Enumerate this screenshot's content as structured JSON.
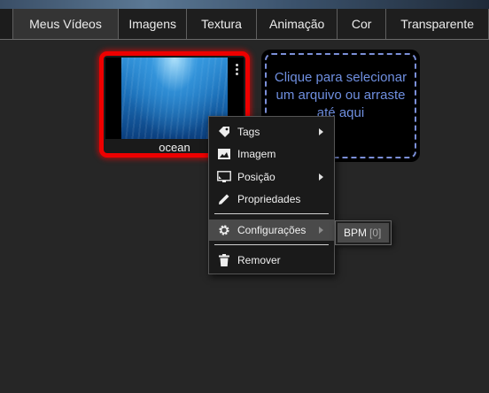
{
  "tabs": [
    {
      "label": "Meus Vídeos",
      "active": true
    },
    {
      "label": "Imagens"
    },
    {
      "label": "Textura"
    },
    {
      "label": "Animação"
    },
    {
      "label": "Cor"
    },
    {
      "label": "Transparente"
    }
  ],
  "video_card": {
    "name": "ocean",
    "selected": true,
    "border_color": "#ee0000"
  },
  "upload_box": {
    "text": "Clique para selecionar um arquivo ou arraste até aqui"
  },
  "context_menu": {
    "items": [
      {
        "label": "Tags",
        "icon": "tag-icon",
        "submenu": true
      },
      {
        "label": "Imagem",
        "icon": "image-icon"
      },
      {
        "label": "Posição",
        "icon": "screen-position-icon",
        "submenu": true
      },
      {
        "label": "Propriedades",
        "icon": "pencil-icon"
      },
      {
        "label": "Configurações",
        "icon": "gear-icon",
        "submenu": true,
        "highlighted": true
      },
      {
        "label": "Remover",
        "icon": "trash-icon"
      }
    ]
  },
  "submenu": {
    "label": "BPM",
    "count": "[0]"
  },
  "colors": {
    "accent_dashed": "#7b8fd8",
    "menu_highlight": "#4a4a4a",
    "background": "#262626"
  }
}
